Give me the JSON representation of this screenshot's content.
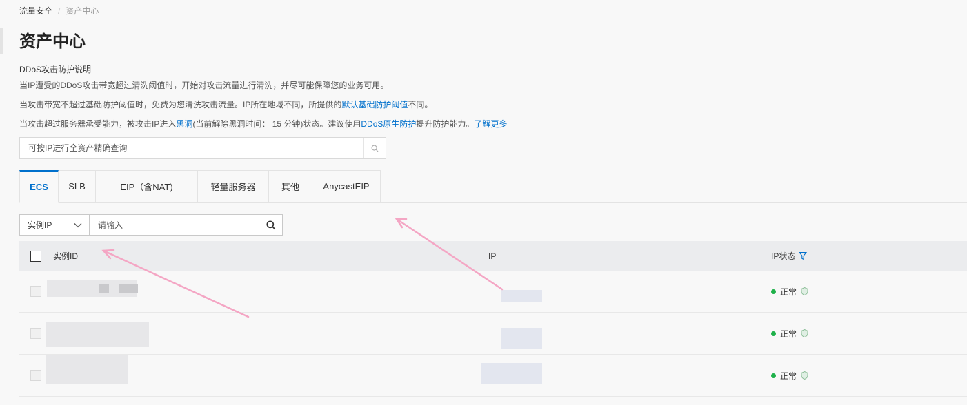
{
  "breadcrumb": {
    "parent": "流量安全",
    "separator": "/",
    "current": "资产中心"
  },
  "page_title": "资产中心",
  "description": {
    "title": "DDoS攻击防护说明",
    "line1": "当IP遭受的DDoS攻击带宽超过清洗阈值时，开始对攻击流量进行清洗，并尽可能保障您的业务可用。",
    "line2_prefix": "当攻击带宽不超过基础防护阈值时，免费为您清洗攻击流量。IP所在地域不同，所提供的",
    "line2_link": "默认基础防护阈值",
    "line2_suffix": "不同。",
    "line3_prefix": "当攻击超过服务器承受能力，被攻击IP进入",
    "line3_link1": "黑洞",
    "line3_mid": "(当前解除黑洞时间： 15 分钟)状态。建议使用",
    "line3_link2": "DDoS原生防护",
    "line3_mid2": "提升防护能力。",
    "line3_link3": "了解更多"
  },
  "global_search": {
    "placeholder": "可按IP进行全资产精确查询"
  },
  "tabs": [
    {
      "label": "ECS",
      "active": true
    },
    {
      "label": "SLB"
    },
    {
      "label": "EIP（含NAT)"
    },
    {
      "label": "轻量服务器"
    },
    {
      "label": "其他"
    },
    {
      "label": "AnycastEIP"
    }
  ],
  "filter": {
    "select_value": "实例IP",
    "input_placeholder": "请输入"
  },
  "table": {
    "headers": {
      "id": "实例ID",
      "ip": "IP",
      "status": "IP状态"
    },
    "rows": [
      {
        "status": "正常"
      },
      {
        "status": "正常"
      },
      {
        "status": "正常"
      }
    ]
  },
  "colors": {
    "accent": "#0070cc",
    "status_ok": "#1fb14a",
    "arrow": "#f4a6c4"
  }
}
